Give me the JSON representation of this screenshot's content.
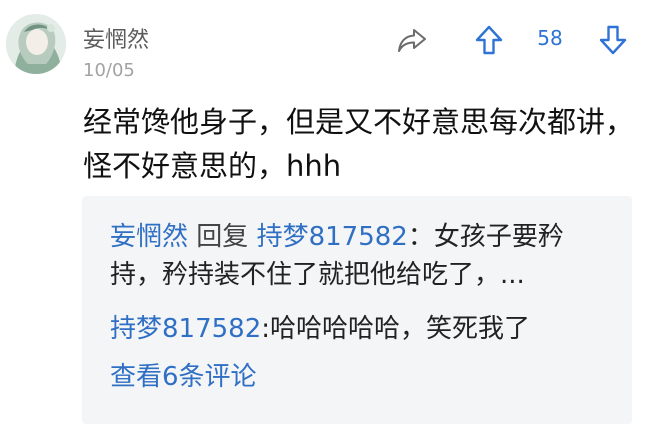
{
  "comment": {
    "author": "妄惘然",
    "date": "10/05",
    "score": "58",
    "text": "经常馋他身子，但是又不好意思每次都讲，怪不好意思的，hhh"
  },
  "replies": {
    "first": {
      "author": "妄惘然",
      "action": "回复",
      "target": "持梦817582",
      "separator": "：",
      "text": "女孩子要矜持，矜持装不住了就把他给吃了，..."
    },
    "second": {
      "author": "持梦817582",
      "separator": ":",
      "text": "哈哈哈哈哈，笑死我了"
    },
    "view_more": "查看6条评论"
  },
  "icons": {
    "share": "share-icon",
    "upvote": "arrow-up-icon",
    "downvote": "arrow-down-icon"
  },
  "colors": {
    "accent": "#2f73d6",
    "link": "#2f6fc4",
    "reply_bg": "#f4f5f7"
  }
}
